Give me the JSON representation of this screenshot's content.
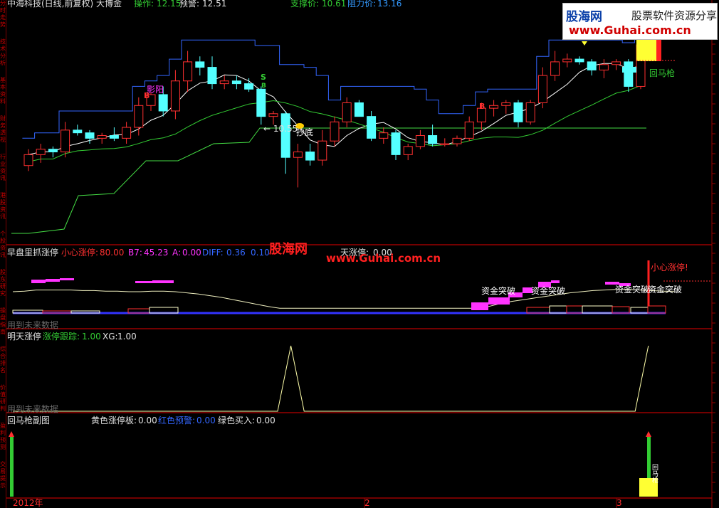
{
  "header": {
    "title": "中海科技(日线,前复权) 大博金",
    "op_label": "操作:",
    "op_value": "12.15",
    "warn_label": "预警:",
    "warn_value": "12.51",
    "support_label": "支撑价:",
    "support_value": "10.61",
    "resist_label": "阻力价:",
    "resist_value": "13.16"
  },
  "watermark": {
    "logo_cn": "股海网",
    "slogan": "股票软件资源分享",
    "url": "www.Guhai.com.cn",
    "mid_cn": "股海网",
    "mid_url": "www.Guhai.com.cn"
  },
  "side_tabs": [
    "分时走势",
    "技术分析",
    "基本资料",
    "财务透视",
    "行业资讯",
    "港股资讯",
    "个股资讯",
    "股东研究",
    "操盘指南",
    "综合排名",
    "价值研判",
    "盈利预测",
    "交易提示"
  ],
  "annotations": {
    "shadow_yang": "影阳",
    "buy_B1": "B",
    "buy_B2": "B",
    "sell_S": "S",
    "sell_S2": "B",
    "low_price": "← 10.55",
    "bottom_fish": "抄底",
    "return_spear": "回马枪",
    "careful_limit": "小心涨停!",
    "fund_break_1": "资金突破",
    "fund_break_2": "资金突破",
    "fund_break_3": "资金突破",
    "fund_break_4": "资金突破",
    "bottom_signal": "回马枪"
  },
  "panel2": {
    "name": "早盘里抓涨停",
    "careful_label": "小心涨停:",
    "careful_value": "80.00",
    "b7_label": "B7:",
    "b7_value": "45.23",
    "a_label": "A:",
    "a_value": "0.00",
    "diff_label": "DIFF:",
    "diff_value": "0.36",
    "v2_value": "0.10",
    "zt_label": "天涨停:",
    "zt_value": "0.00",
    "future_note": "用到未来数据"
  },
  "panel3": {
    "name": "明天涨停",
    "track_label": "涨停跟踪:",
    "track_value": "1.00",
    "xg_label": "XG:",
    "xg_value": "1.00",
    "future_note": "用到未来数据"
  },
  "panel4": {
    "name": "回马枪副图",
    "yellow_label": "黄色涨停板:",
    "yellow_value": "0.00",
    "red_label": "红色预警:",
    "red_value": "0.00",
    "green_label": "绿色买入:",
    "green_value": "0.00"
  },
  "xaxis": {
    "year_label": "2012年",
    "month_2": "2",
    "month_3": "3"
  },
  "colors": {
    "up": "#ff3030",
    "down": "#54ffff",
    "ma": "#ffffff",
    "ma_green": "#33cc33",
    "stop_line": "#3366ff",
    "support_line": "#44dd44",
    "magenta": "#ff33ff",
    "yellow": "#ffff33",
    "frame": "#990000"
  },
  "chart_data": {
    "type": "candlestick",
    "main": {
      "ohlc": [
        [
          10.95,
          11.25,
          10.85,
          11.15
        ],
        [
          11.15,
          11.35,
          11.0,
          11.25
        ],
        [
          11.25,
          11.3,
          11.1,
          11.2
        ],
        [
          11.2,
          11.75,
          11.1,
          11.6
        ],
        [
          11.6,
          11.7,
          11.5,
          11.55
        ],
        [
          11.55,
          11.6,
          11.35,
          11.45
        ],
        [
          11.45,
          11.55,
          11.35,
          11.5
        ],
        [
          11.5,
          11.65,
          11.4,
          11.45
        ],
        [
          11.45,
          11.75,
          11.35,
          11.65
        ],
        [
          11.65,
          12.2,
          11.5,
          12.05
        ],
        [
          12.05,
          12.3,
          11.95,
          12.25
        ],
        [
          12.25,
          12.4,
          11.85,
          11.95
        ],
        [
          11.95,
          12.7,
          11.8,
          12.5
        ],
        [
          12.5,
          13.05,
          12.3,
          12.85
        ],
        [
          12.85,
          12.95,
          12.6,
          12.75
        ],
        [
          12.75,
          12.95,
          12.35,
          12.45
        ],
        [
          12.45,
          12.6,
          12.35,
          12.5
        ],
        [
          12.5,
          12.6,
          12.35,
          12.45
        ],
        [
          12.45,
          12.55,
          12.3,
          12.35
        ],
        [
          12.35,
          12.4,
          11.7,
          11.85
        ],
        [
          11.85,
          11.95,
          11.7,
          11.9
        ],
        [
          11.9,
          11.95,
          10.8,
          11.1
        ],
        [
          11.1,
          11.35,
          10.55,
          11.2
        ],
        [
          11.2,
          11.35,
          10.95,
          11.05
        ],
        [
          11.05,
          11.6,
          10.95,
          11.4
        ],
        [
          11.4,
          11.85,
          11.3,
          11.75
        ],
        [
          11.75,
          12.2,
          11.65,
          12.1
        ],
        [
          12.1,
          12.15,
          11.85,
          11.85
        ],
        [
          11.85,
          11.95,
          11.4,
          11.45
        ],
        [
          11.45,
          11.65,
          11.35,
          11.55
        ],
        [
          11.55,
          11.6,
          11.05,
          11.15
        ],
        [
          11.15,
          11.35,
          11.05,
          11.3
        ],
        [
          11.3,
          11.6,
          11.25,
          11.5
        ],
        [
          11.5,
          11.7,
          11.3,
          11.35
        ],
        [
          11.35,
          11.45,
          11.3,
          11.35
        ],
        [
          11.35,
          11.5,
          11.3,
          11.45
        ],
        [
          11.45,
          11.85,
          11.4,
          11.75
        ],
        [
          11.75,
          12.1,
          11.6,
          12.0
        ],
        [
          12.0,
          12.15,
          11.85,
          12.05
        ],
        [
          12.05,
          12.15,
          11.9,
          12.1
        ],
        [
          12.1,
          12.15,
          11.65,
          11.75
        ],
        [
          11.75,
          12.15,
          11.7,
          12.1
        ],
        [
          12.1,
          12.75,
          12.0,
          12.6
        ],
        [
          12.6,
          13.05,
          12.5,
          12.85
        ],
        [
          12.85,
          13.0,
          12.75,
          12.9
        ],
        [
          12.9,
          12.95,
          12.8,
          12.85
        ],
        [
          12.85,
          12.9,
          12.6,
          12.7
        ],
        [
          12.7,
          12.9,
          12.55,
          12.8
        ],
        [
          12.8,
          12.9,
          12.7,
          12.85
        ],
        [
          12.85,
          12.9,
          12.3,
          12.4
        ],
        [
          12.4,
          13.16,
          12.35,
          13.16
        ]
      ],
      "ylim": [
        9.5,
        13.8
      ]
    },
    "panel2": {
      "white_line": [
        45,
        46,
        48,
        48,
        48,
        48,
        47,
        47,
        46,
        46,
        45,
        45,
        46,
        46,
        45,
        43,
        41,
        38,
        35,
        31,
        27,
        23,
        19,
        16,
        16,
        16,
        16,
        16,
        16,
        16,
        16,
        16,
        16,
        16,
        16,
        16,
        16,
        16,
        16,
        16,
        16,
        19,
        24,
        28,
        31,
        34,
        37,
        40,
        43,
        45,
        47,
        48,
        49,
        49,
        48,
        47,
        46,
        45.23
      ],
      "magenta_segments": [
        [
          1,
          3
        ],
        [
          3,
          5
        ],
        [
          7,
          9
        ],
        [
          27,
          28
        ],
        [
          28,
          29
        ],
        [
          29,
          30
        ],
        [
          31,
          32
        ],
        [
          32,
          33
        ],
        [
          37,
          38
        ],
        [
          46,
          47
        ],
        [
          47,
          48
        ],
        [
          48,
          49
        ]
      ],
      "ylim": [
        0,
        100
      ]
    },
    "panel3": {
      "line": [
        0,
        0,
        0,
        0,
        0,
        0,
        0,
        0,
        0,
        0,
        0,
        0,
        0,
        0,
        0,
        0,
        0,
        0,
        0,
        0,
        0,
        1,
        0,
        0,
        0,
        0,
        0,
        0,
        0,
        0,
        0,
        0,
        0,
        0,
        0,
        0,
        0,
        0,
        0,
        0,
        0,
        0,
        0,
        0,
        0,
        0,
        0,
        0,
        1
      ],
      "ylim": [
        0,
        1.1
      ]
    }
  }
}
